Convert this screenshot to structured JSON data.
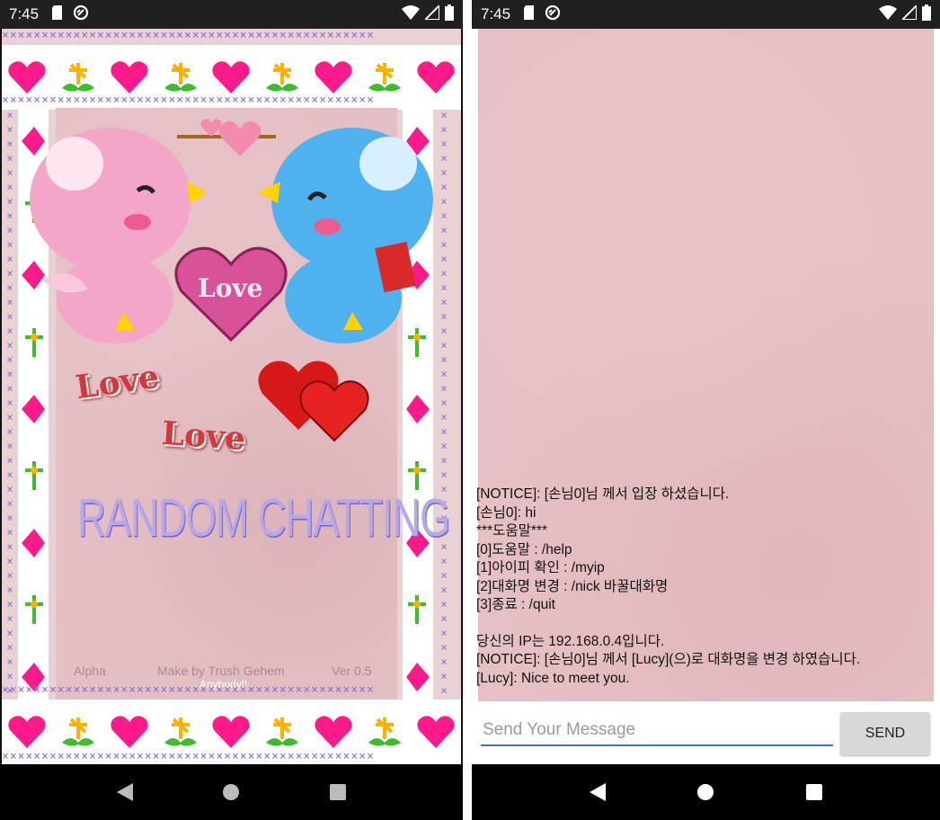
{
  "colors": {
    "accent": "#3f6fd8",
    "heart": "#ff1a8c",
    "cross": "#8a6cd8"
  },
  "left_screen": {
    "status_time": "7:45",
    "love_text_1": "Love",
    "love_text_2": "Love",
    "heart_label": "Love",
    "title": "RANDOM CHATTING",
    "footer_left": "Alpha",
    "footer_center": "Make by Trush Gehem",
    "footer_center_sub": "Anybody!!",
    "footer_right": "Ver 0.5"
  },
  "right_screen": {
    "status_time": "7:45",
    "messages": [
      "[NOTICE]: [손님0]님 께서 입장 하셨습니다.",
      "[손님0]: hi",
      "***도움말***",
      "[0]도움말 : /help",
      "[1]아이피 확인 : /myip",
      "[2]대화명 변경 : /nick 바꿀대화명",
      "[3]종료 : /quit",
      "",
      "당신의 IP는 192.168.0.4입니다.",
      "[NOTICE]: [손님0]님 께서 [Lucy](으)로 대화명을 변경 하였습니다.",
      "[Lucy]: Nice to meet you."
    ],
    "input_placeholder": "Send Your Message",
    "input_value": "",
    "send_label": "SEND"
  }
}
